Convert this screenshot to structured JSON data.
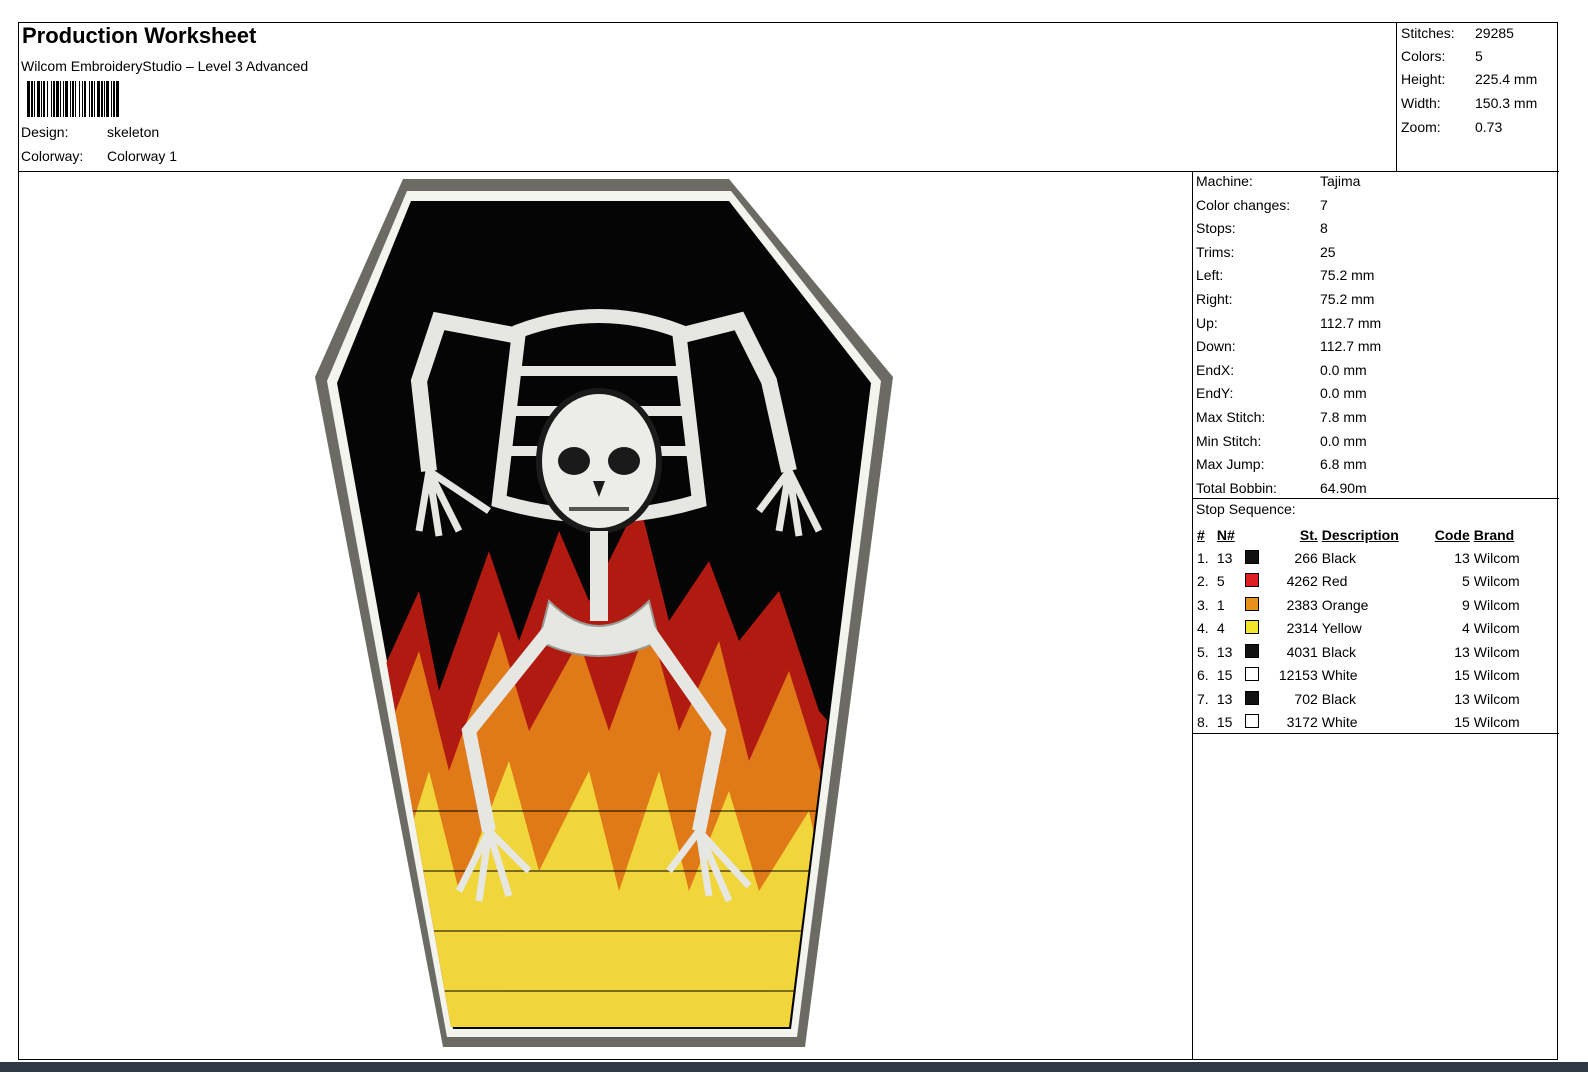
{
  "header": {
    "title": "Production Worksheet",
    "subtitle": "Wilcom EmbroideryStudio – Level 3  Advanced",
    "design_label": "Design:",
    "design_value": "skeleton",
    "colorway_label": "Colorway:",
    "colorway_value": "Colorway 1"
  },
  "summary": [
    {
      "label": "Stitches:",
      "value": "29285"
    },
    {
      "label": "Colors:",
      "value": "5"
    },
    {
      "label": "Height:",
      "value": "225.4 mm"
    },
    {
      "label": "Width:",
      "value": "150.3 mm"
    },
    {
      "label": "Zoom:",
      "value": "0.73"
    }
  ],
  "machine_info": [
    {
      "label": "Machine:",
      "value": "Tajima"
    },
    {
      "label": "Color changes:",
      "value": "7"
    },
    {
      "label": "Stops:",
      "value": "8"
    },
    {
      "label": "Trims:",
      "value": "25"
    },
    {
      "label": "Left:",
      "value": "75.2 mm"
    },
    {
      "label": "Right:",
      "value": "75.2 mm"
    },
    {
      "label": "Up:",
      "value": "112.7 mm"
    },
    {
      "label": "Down:",
      "value": "112.7 mm"
    },
    {
      "label": "EndX:",
      "value": "0.0 mm"
    },
    {
      "label": "EndY:",
      "value": "0.0 mm"
    },
    {
      "label": "Max Stitch:",
      "value": "7.8 mm"
    },
    {
      "label": "Min Stitch:",
      "value": "0.0 mm"
    },
    {
      "label": "Max Jump:",
      "value": "6.8 mm"
    },
    {
      "label": "Total Bobbin:",
      "value": "64.90m"
    }
  ],
  "stop_sequence": {
    "title": "Stop Sequence:",
    "columns": [
      "#",
      "N#",
      "St.",
      "Description",
      "Code",
      "Brand"
    ],
    "rows": [
      {
        "n": "1.",
        "needle": "13",
        "color": "#111111",
        "st": "266",
        "desc": "Black",
        "code": "13",
        "brand": "Wilcom"
      },
      {
        "n": "2.",
        "needle": "5",
        "color": "#e02020",
        "st": "4262",
        "desc": "Red",
        "code": "5",
        "brand": "Wilcom"
      },
      {
        "n": "3.",
        "needle": "1",
        "color": "#e8901c",
        "st": "2383",
        "desc": "Orange",
        "code": "9",
        "brand": "Wilcom"
      },
      {
        "n": "4.",
        "needle": "4",
        "color": "#f2e52a",
        "st": "2314",
        "desc": "Yellow",
        "code": "4",
        "brand": "Wilcom"
      },
      {
        "n": "5.",
        "needle": "13",
        "color": "#111111",
        "st": "4031",
        "desc": "Black",
        "code": "13",
        "brand": "Wilcom"
      },
      {
        "n": "6.",
        "needle": "15",
        "color": "#ffffff",
        "st": "12153",
        "desc": "White",
        "code": "15",
        "brand": "Wilcom"
      },
      {
        "n": "7.",
        "needle": "13",
        "color": "#111111",
        "st": "702",
        "desc": "Black",
        "code": "13",
        "brand": "Wilcom"
      },
      {
        "n": "8.",
        "needle": "15",
        "color": "#ffffff",
        "st": "3172",
        "desc": "White",
        "code": "15",
        "brand": "Wilcom"
      }
    ]
  },
  "design_preview": {
    "shape": "coffin",
    "colors": {
      "border": "#6b6b63",
      "outline": "#f4f4ee",
      "fill": "#050505",
      "bone": "#e6e6e2",
      "flame_red": "#b01a10",
      "flame_orange": "#e07a18",
      "flame_yellow": "#f0d63a"
    }
  }
}
